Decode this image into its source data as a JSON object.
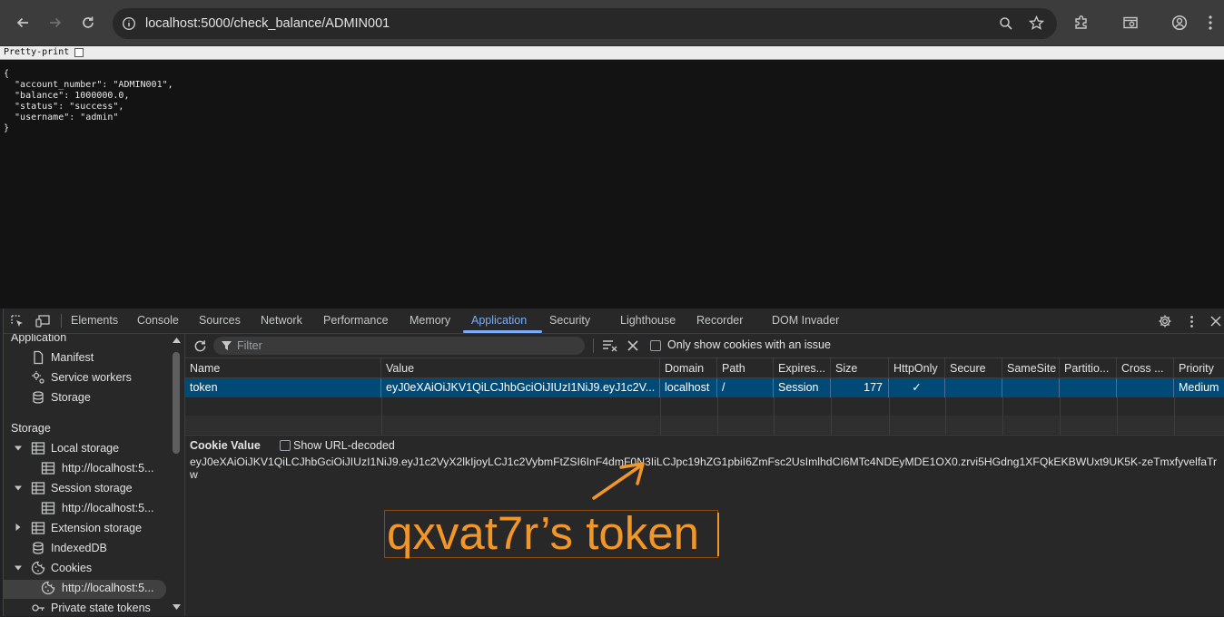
{
  "browser": {
    "url": "localhost:5000/check_balance/ADMIN001"
  },
  "page": {
    "pretty_print_label": "Pretty-print",
    "json_text": "{\n  \"account_number\": \"ADMIN001\",\n  \"balance\": 1000000.0,\n  \"status\": \"success\",\n  \"username\": \"admin\"\n}"
  },
  "devtools": {
    "tabs": [
      "Elements",
      "Console",
      "Sources",
      "Network",
      "Performance",
      "Memory",
      "Application",
      "Security",
      "Lighthouse",
      "Recorder",
      "DOM Invader"
    ],
    "active_tab": "Application",
    "sidebar": {
      "application_header": "Application",
      "manifest": "Manifest",
      "service_workers": "Service workers",
      "storage_item": "Storage",
      "storage_header": "Storage",
      "local_storage": "Local storage",
      "local_storage_origin": "http://localhost:5...",
      "session_storage": "Session storage",
      "session_storage_origin": "http://localhost:5...",
      "extension_storage": "Extension storage",
      "indexeddb": "IndexedDB",
      "cookies": "Cookies",
      "cookies_origin": "http://localhost:5...",
      "private_state_tokens": "Private state tokens"
    },
    "filter_placeholder": "Filter",
    "only_issues_label": "Only show cookies with an issue",
    "table": {
      "headers": [
        "Name",
        "Value",
        "Domain",
        "Path",
        "Expires...",
        "Size",
        "HttpOnly",
        "Secure",
        "SameSite",
        "Partitio...",
        "Cross ...",
        "Priority"
      ],
      "row": {
        "name": "token",
        "value": "eyJ0eXAiOiJKV1QiLCJhbGciOiJIUzI1NiJ9.eyJ1c2V...",
        "domain": "localhost",
        "path": "/",
        "expires": "Session",
        "size": "177",
        "httponly": "✓",
        "priority": "Medium"
      }
    },
    "cookie_value_label": "Cookie Value",
    "show_url_decoded_label": "Show URL-decoded",
    "cookie_value": "eyJ0eXAiOiJKV1QiLCJhbGciOiJIUzI1NiJ9.eyJ1c2VyX2lkIjoyLCJ1c2VybmFtZSI6InF4dmF0N3IiLCJpc19hZG1pbiI6ZmFsc2UsImlhdCI6MTc4NDEyMDE1OX0.zrvi5HGdng1XFQkEKBWUxt9UK5K-zeTmxfyvelfaTrw",
    "annotation": "qxvat7r’s token"
  },
  "colors": {
    "accent": "#7cacf8",
    "selected_row": "#004a77",
    "annotation": "#f0962a"
  }
}
